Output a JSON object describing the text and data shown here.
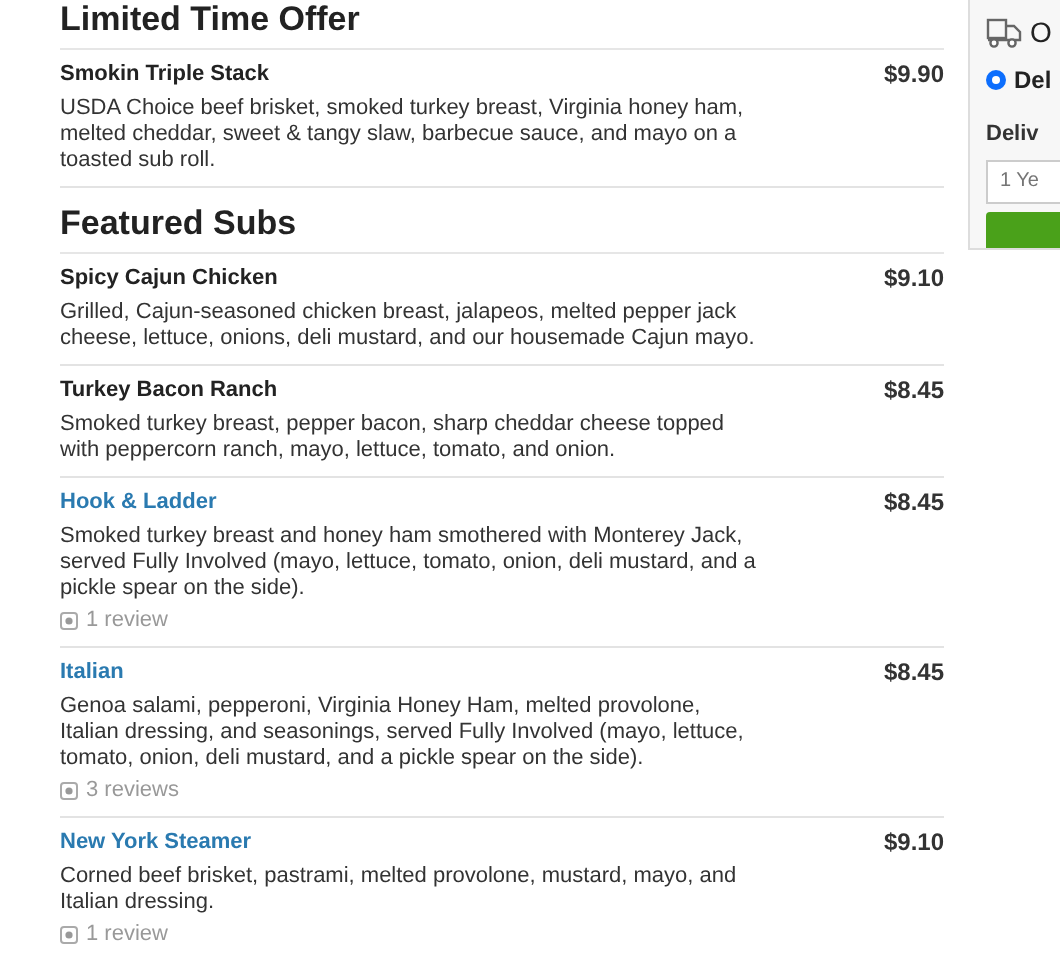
{
  "sections": [
    {
      "title": "Limited Time Offer",
      "items": [
        {
          "name": "Smokin Triple  Stack",
          "linked": false,
          "price": "$9.90",
          "description": "USDA Choice beef brisket, smoked turkey breast, Virginia honey ham, melted cheddar, sweet & tangy slaw, barbecue sauce, and mayo on a toasted sub roll."
        }
      ]
    },
    {
      "title": "Featured Subs",
      "items": [
        {
          "name": "Spicy Cajun Chicken",
          "linked": false,
          "price": "$9.10",
          "description": "Grilled, Cajun-seasoned chicken breast, jalapeos, melted pepper jack cheese, lettuce, onions, deli mustard, and our housemade Cajun mayo."
        },
        {
          "name": "Turkey Bacon Ranch",
          "linked": false,
          "price": "$8.45",
          "description": "Smoked turkey breast, pepper bacon, sharp cheddar cheese topped with peppercorn ranch, mayo, lettuce, tomato, and onion."
        },
        {
          "name": "Hook & Ladder",
          "linked": true,
          "price": "$8.45",
          "description": "Smoked turkey breast and honey ham smothered with Monterey Jack, served Fully Involved (mayo, lettuce, tomato, onion, deli mustard, and a pickle spear on the side).",
          "reviews": "1 review"
        },
        {
          "name": "Italian",
          "linked": true,
          "price": "$8.45",
          "description": "Genoa salami, pepperoni, Virginia Honey Ham, melted provolone, Italian dressing, and seasonings, served Fully Involved (mayo, lettuce, tomato, onion, deli mustard, and a pickle spear on the side).",
          "reviews": "3 reviews"
        },
        {
          "name": "New York Steamer",
          "linked": true,
          "price": "$9.10",
          "description": "Corned beef brisket, pastrami, melted provolone, mustard, mayo, and Italian dressing.",
          "reviews": "1 review"
        }
      ]
    }
  ],
  "order_panel": {
    "title": "O",
    "option": {
      "label": "Del",
      "selected": true
    },
    "field_label": "Deliv",
    "placeholder": "1 Ye"
  }
}
